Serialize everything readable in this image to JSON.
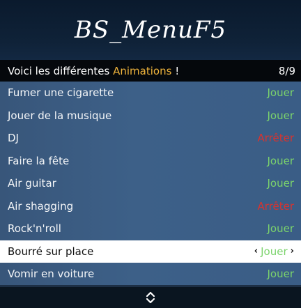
{
  "banner": {
    "title": "BS_MenuF5"
  },
  "subheader": {
    "prefix": "Voici les différentes ",
    "accent": "Animations",
    "suffix": " !",
    "counter": "8/9"
  },
  "items": [
    {
      "label": "Fumer une cigarette",
      "action": "Jouer"
    },
    {
      "label": "Jouer de la musique",
      "action": "Jouer"
    },
    {
      "label": "DJ",
      "action": "Arrêter"
    },
    {
      "label": "Faire la fête",
      "action": "Jouer"
    },
    {
      "label": "Air guitar",
      "action": "Jouer"
    },
    {
      "label": "Air shagging",
      "action": "Arrêter"
    },
    {
      "label": "Rock'n'roll",
      "action": "Jouer"
    },
    {
      "label": "Bourré sur place",
      "action": "Jouer",
      "left_arrow": "‹",
      "right_arrow": "›"
    },
    {
      "label": "Vomir en voiture",
      "action": "Jouer"
    }
  ],
  "colors": {
    "play": "#7bd36c",
    "stop": "#d9332e",
    "accent": "#f0b43c"
  },
  "footer": {
    "icon": "up-down-chevron-icon"
  }
}
